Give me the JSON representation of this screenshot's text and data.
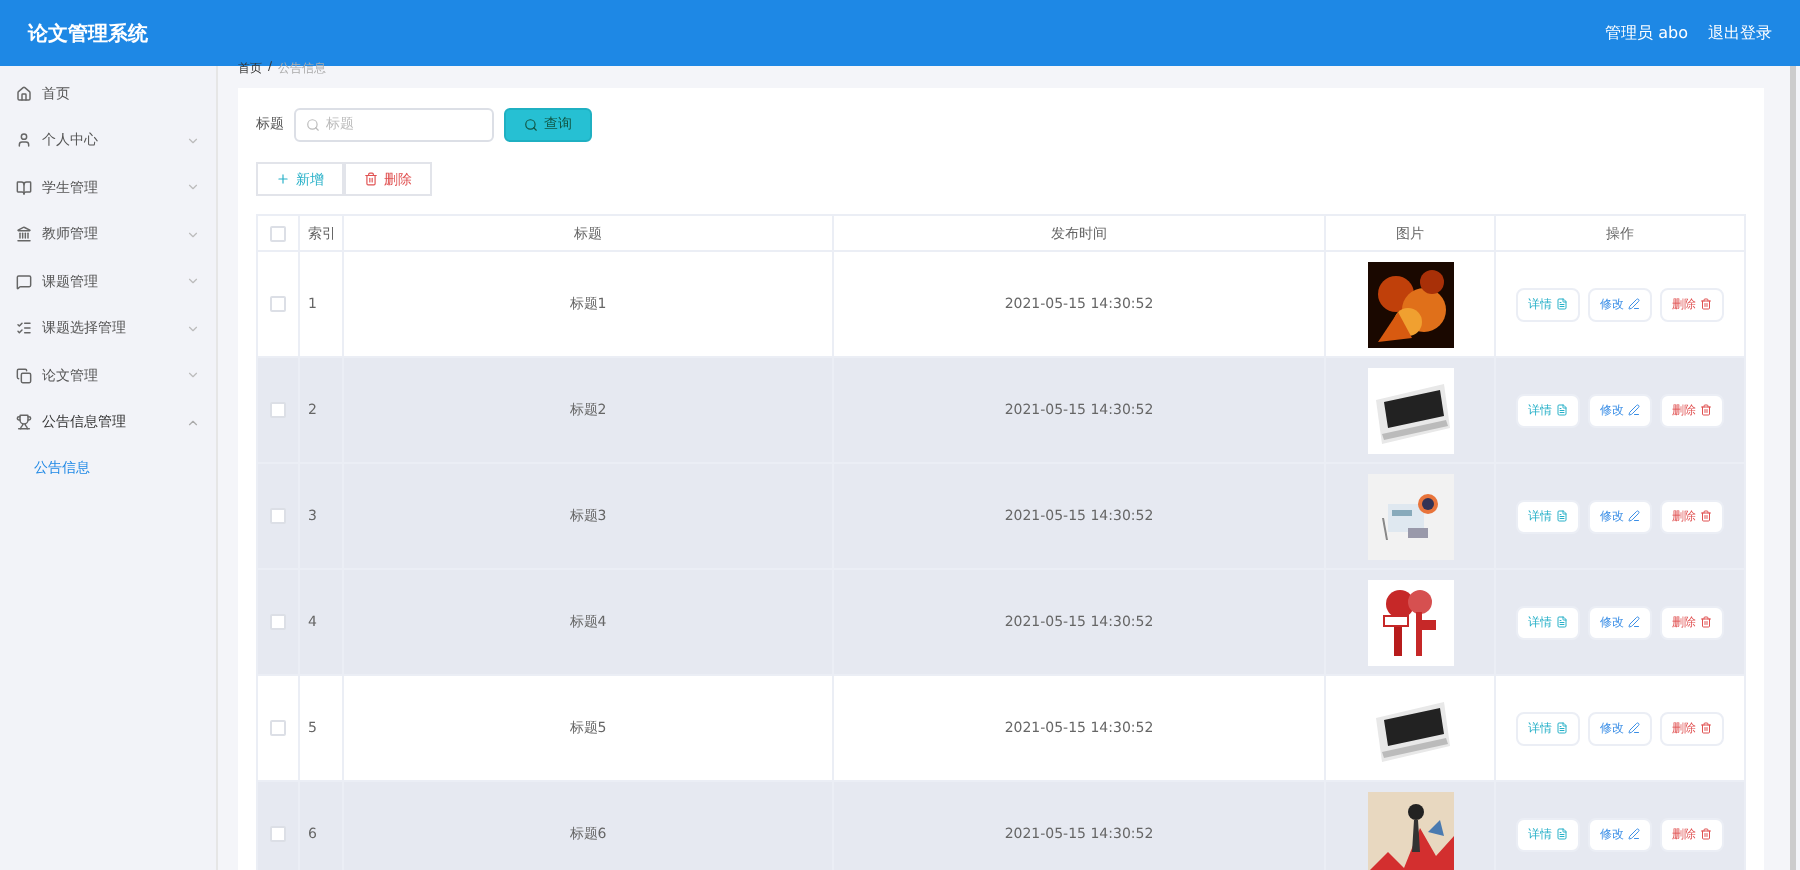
{
  "header": {
    "title": "论文管理系统",
    "user": "管理员 abo",
    "logout": "退出登录"
  },
  "sidebar": {
    "items": [
      {
        "label": "首页",
        "kind": "link"
      },
      {
        "label": "个人中心",
        "kind": "group",
        "expanded": false
      },
      {
        "label": "学生管理",
        "kind": "group",
        "expanded": false
      },
      {
        "label": "教师管理",
        "kind": "group",
        "expanded": false
      },
      {
        "label": "课题管理",
        "kind": "group",
        "expanded": false
      },
      {
        "label": "课题选择管理",
        "kind": "group",
        "expanded": false
      },
      {
        "label": "论文管理",
        "kind": "group",
        "expanded": false
      },
      {
        "label": "公告信息管理",
        "kind": "group",
        "expanded": true,
        "children": [
          {
            "label": "公告信息",
            "selected": true
          }
        ]
      }
    ]
  },
  "breadcrumb": {
    "items": [
      "首页",
      "公告信息"
    ],
    "separator": "/"
  },
  "search": {
    "label": "标题",
    "placeholder": "标题",
    "button": "查询"
  },
  "actions": {
    "add": "新增",
    "delete": "删除"
  },
  "table": {
    "select_all_checked": false,
    "columns": [
      "索引",
      "标题",
      "发布时间",
      "图片",
      "操作"
    ],
    "rows": [
      {
        "index": "1",
        "title": "标题1",
        "time": "2021-05-15 14:30:52",
        "checked": false,
        "highlighted": false,
        "buttons": [
          "详情",
          "修改",
          "删除"
        ]
      },
      {
        "index": "2",
        "title": "标题2",
        "time": "2021-05-15 14:30:52",
        "checked": false,
        "highlighted": true,
        "buttons": [
          "详情",
          "修改",
          "删除"
        ]
      },
      {
        "index": "3",
        "title": "标题3",
        "time": "2021-05-15 14:30:52",
        "checked": false,
        "highlighted": true,
        "buttons": [
          "详情",
          "修改",
          "删除"
        ]
      },
      {
        "index": "4",
        "title": "标题4",
        "time": "2021-05-15 14:30:52",
        "checked": false,
        "highlighted": true,
        "buttons": [
          "详情",
          "修改",
          "删除"
        ]
      },
      {
        "index": "5",
        "title": "标题5",
        "time": "2021-05-15 14:30:52",
        "checked": false,
        "highlighted": false,
        "buttons": [
          "详情",
          "修改",
          "删除"
        ]
      },
      {
        "index": "6",
        "title": "标题6",
        "time": "2021-05-15 14:30:52",
        "checked": false,
        "highlighted": true,
        "buttons": [
          "详情",
          "修改",
          "删除"
        ]
      }
    ]
  }
}
